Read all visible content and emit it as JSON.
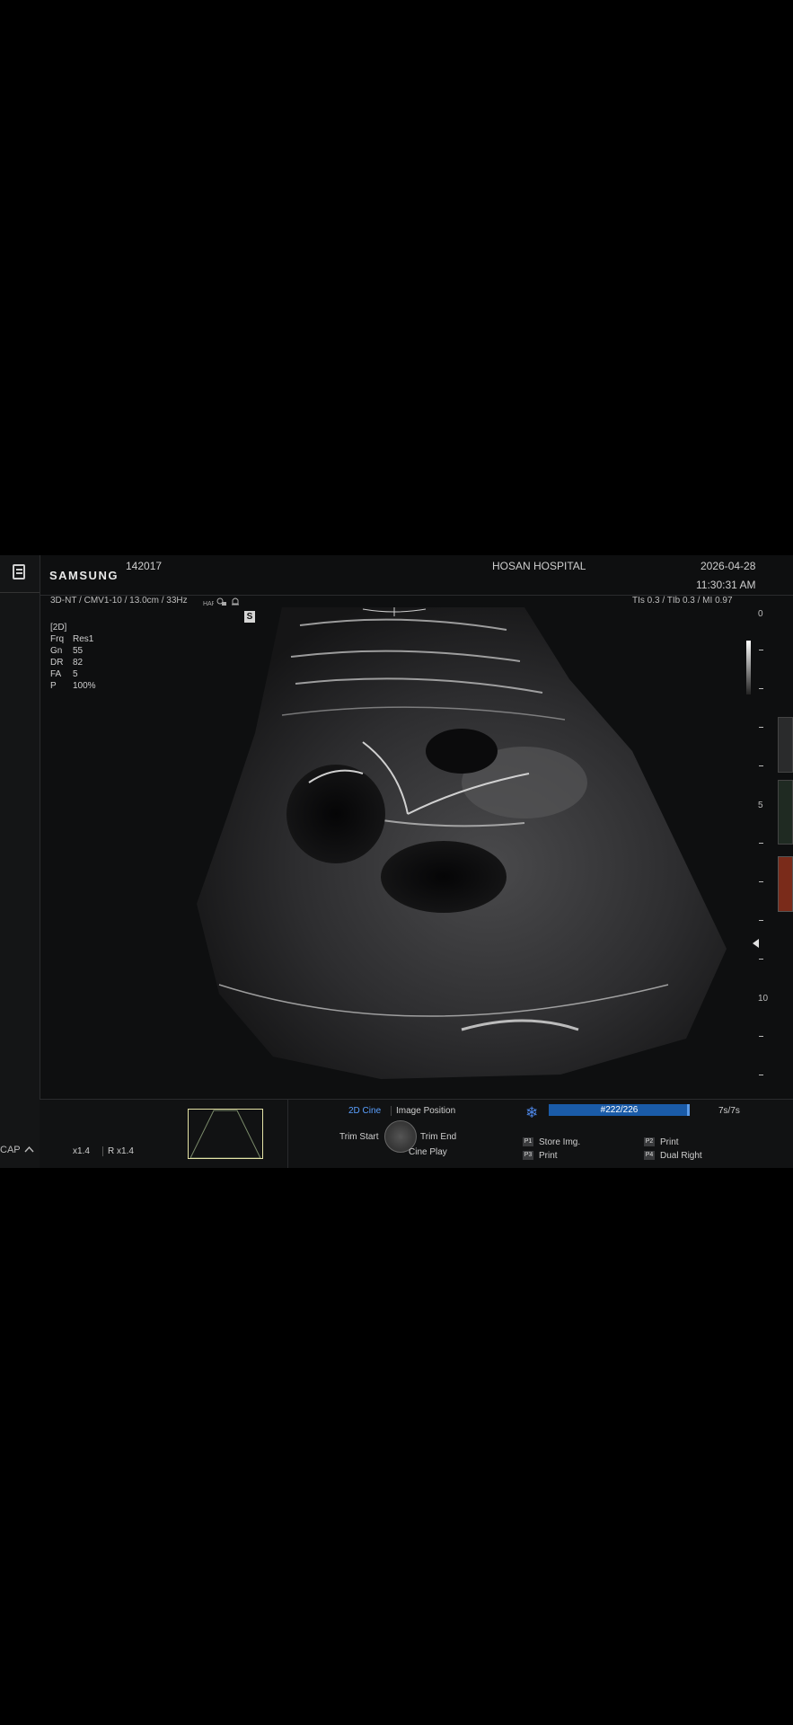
{
  "header": {
    "brand": "SAMSUNG",
    "patient_id": "142017",
    "hospital": "HOSAN HOSPITAL",
    "date": "2026-04-28",
    "time": "11:30:31 AM"
  },
  "scan_info": {
    "probe_line": "3D-NT / CMV1-10 / 13.0cm / 33Hz",
    "thermal_line": "TIs   0.3 / TIb   0.3 / MI   0.97",
    "s_badge": "S"
  },
  "params": {
    "mode": "[2D]",
    "rows": [
      {
        "key": "Frq",
        "value": "Res1"
      },
      {
        "key": "Gn",
        "value": "55"
      },
      {
        "key": "DR",
        "value": "82"
      },
      {
        "key": "FA",
        "value": "5"
      },
      {
        "key": "P",
        "value": "100%"
      }
    ]
  },
  "depth_scale": {
    "labels": [
      "0",
      "5",
      "10"
    ]
  },
  "sidebar": {
    "cap_label": "CAP"
  },
  "bottom": {
    "zoom_x": "x1.4",
    "zoom_r": "R x1.4",
    "cine_tab": "2D Cine",
    "image_position_tab": "Image Position",
    "trim_start": "Trim Start",
    "trim_end": "Trim End",
    "cine_play": "Cine Play",
    "frame_label": "#222/226",
    "frame_fraction": 0.982,
    "duration": "7s/7s",
    "function_keys": [
      {
        "badge": "P1",
        "label": "Store Img."
      },
      {
        "badge": "P2",
        "label": "Print"
      },
      {
        "badge": "P3",
        "label": "Print"
      },
      {
        "badge": "P4",
        "label": "Dual Right"
      }
    ]
  },
  "colors": {
    "accent_blue": "#5aa0ff",
    "progress_blue": "#0f4f9c",
    "freeze_icon": "#4d86e6",
    "thumb_border": "#e5e3a6"
  }
}
